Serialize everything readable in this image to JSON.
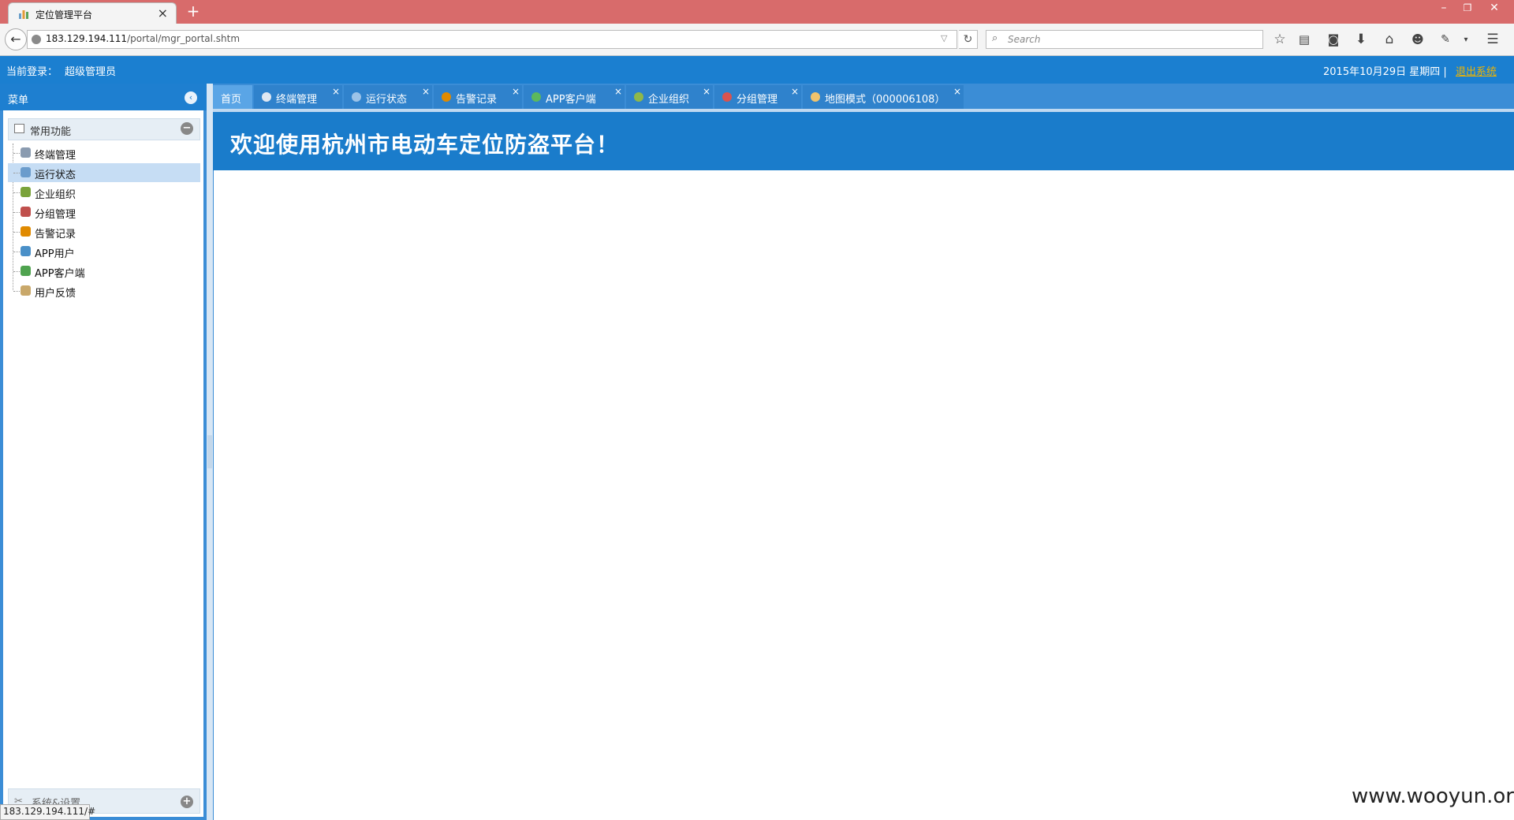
{
  "browser": {
    "tab_title": "定位管理平台",
    "new_tab": "+",
    "close_tab": "×",
    "url_host": "183.129.194.111",
    "url_path": "/portal/mgr_portal.shtm",
    "search_placeholder": "Search",
    "back": "←",
    "reload": "↻",
    "status_url": "183.129.194.111/#",
    "window_controls": {
      "minimize": "–",
      "restore": "❐",
      "close": "✕"
    }
  },
  "header": {
    "login_label": "当前登录：",
    "login_user": "超级管理员",
    "date": "2015年10月29日 星期四 |",
    "logout": "退出系统"
  },
  "sidebar": {
    "title": "菜单",
    "collapse_glyph": "‹",
    "group_title": "常用功能",
    "group_toggle": "−",
    "items": [
      {
        "label": "终端管理",
        "icon": "search-icon",
        "color": "#8a9bb0"
      },
      {
        "label": "运行状态",
        "icon": "monitor-icon",
        "color": "#6b9ccc"
      },
      {
        "label": "企业组织",
        "icon": "organization-icon",
        "color": "#7aa33a"
      },
      {
        "label": "分组管理",
        "icon": "group-icon",
        "color": "#c0504d"
      },
      {
        "label": "告警记录",
        "icon": "warning-icon",
        "color": "#e08a00"
      },
      {
        "label": "APP用户",
        "icon": "app-user-icon",
        "color": "#4a90c8"
      },
      {
        "label": "APP客户端",
        "icon": "app-client-icon",
        "color": "#4fa34f"
      },
      {
        "label": "用户反馈",
        "icon": "feedback-icon",
        "color": "#c9a86a"
      }
    ],
    "selected_index": 1,
    "group2_title": "系统&设置",
    "group2_toggle": "+"
  },
  "tabs": [
    {
      "label": "首页",
      "icon": null,
      "closable": false,
      "active": true
    },
    {
      "label": "终端管理",
      "icon": "search-icon",
      "closable": true,
      "active": false
    },
    {
      "label": "运行状态",
      "icon": "monitor-icon",
      "closable": true,
      "active": false
    },
    {
      "label": "告警记录",
      "icon": "warning-icon",
      "closable": true,
      "active": false
    },
    {
      "label": "APP客户端",
      "icon": "app-client-icon",
      "closable": true,
      "active": false
    },
    {
      "label": "企业组织",
      "icon": "organization-icon",
      "closable": true,
      "active": false
    },
    {
      "label": "分组管理",
      "icon": "group-icon",
      "closable": true,
      "active": false
    },
    {
      "label": "地图模式（000006108）",
      "icon": "map-icon",
      "closable": true,
      "active": false
    }
  ],
  "tab_close": "×",
  "main": {
    "welcome": "欢迎使用杭州市电动车定位防盗平台！"
  },
  "watermark": "www.wooyun.org",
  "colors": {
    "title_bar": "#d86b6b",
    "header_blue": "#1b7fd0",
    "logout_link": "#f0b400",
    "selected_item": "#c6ddf4"
  }
}
